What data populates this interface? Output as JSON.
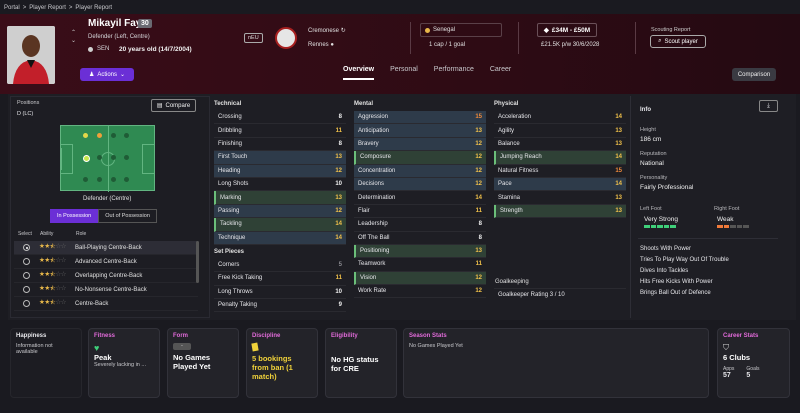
{
  "breadcrumb": [
    "Portal",
    "Player Report",
    "Player Report"
  ],
  "player": {
    "name": "Mikayil Faye",
    "number": "30",
    "position": "Defender (Left, Centre)",
    "nationality_code": "SEN",
    "age": "20 years old (14/7/2004)",
    "eu": "nEU"
  },
  "clubs": {
    "current": "Cremonese",
    "parent": "Rennes"
  },
  "nation": {
    "name": "Senegal",
    "caps": "1 cap / 1 goal"
  },
  "value": {
    "range": "£34M - £50M",
    "wage": "£21.5K p/w 30/6/2028"
  },
  "scouting": {
    "label": "Scouting Report",
    "button": "Scout player"
  },
  "actions_label": "Actions",
  "tabs": [
    "Overview",
    "Personal",
    "Performance",
    "Career"
  ],
  "comparison_label": "Comparison",
  "positions": {
    "label": "Positions",
    "value": "D (LC)",
    "compare_label": "Compare",
    "role_name": "Defender (Centre)",
    "in_possession": "In Possession",
    "out_possession": "Out of Possession",
    "headers": [
      "Select",
      "Ability",
      "Role"
    ],
    "roles": [
      {
        "name": "Ball-Playing Centre-Back",
        "stars": 2.5,
        "selected": true
      },
      {
        "name": "Advanced Centre-Back",
        "stars": 2.5,
        "selected": false
      },
      {
        "name": "Overlapping Centre-Back",
        "stars": 2.5,
        "selected": false
      },
      {
        "name": "No-Nonsense Centre-Back",
        "stars": 2.5,
        "selected": false
      },
      {
        "name": "Centre-Back",
        "stars": 2.5,
        "selected": false
      }
    ]
  },
  "technical": {
    "title": "Technical",
    "rows": [
      {
        "n": "Crossing",
        "v": "8",
        "c": "w",
        "h": ""
      },
      {
        "n": "Dribbling",
        "v": "11",
        "c": "y",
        "h": ""
      },
      {
        "n": "Finishing",
        "v": "8",
        "c": "w",
        "h": ""
      },
      {
        "n": "First Touch",
        "v": "13",
        "c": "y",
        "h": "hl"
      },
      {
        "n": "Heading",
        "v": "12",
        "c": "y",
        "h": "hl"
      },
      {
        "n": "Long Shots",
        "v": "10",
        "c": "w",
        "h": ""
      },
      {
        "n": "Marking",
        "v": "13",
        "c": "y",
        "h": "hlg"
      },
      {
        "n": "Passing",
        "v": "12",
        "c": "y",
        "h": "hl"
      },
      {
        "n": "Tackling",
        "v": "14",
        "c": "y",
        "h": "hlg"
      },
      {
        "n": "Technique",
        "v": "14",
        "c": "y",
        "h": "hl"
      }
    ]
  },
  "setpieces": {
    "title": "Set Pieces",
    "rows": [
      {
        "n": "Corners",
        "v": "5",
        "c": "g",
        "h": ""
      },
      {
        "n": "Free Kick Taking",
        "v": "11",
        "c": "y",
        "h": ""
      },
      {
        "n": "Long Throws",
        "v": "10",
        "c": "w",
        "h": ""
      },
      {
        "n": "Penalty Taking",
        "v": "9",
        "c": "w",
        "h": ""
      }
    ]
  },
  "mental": {
    "title": "Mental",
    "rows": [
      {
        "n": "Aggression",
        "v": "15",
        "c": "o",
        "h": "hl"
      },
      {
        "n": "Anticipation",
        "v": "13",
        "c": "y",
        "h": "hl"
      },
      {
        "n": "Bravery",
        "v": "12",
        "c": "y",
        "h": "hl"
      },
      {
        "n": "Composure",
        "v": "12",
        "c": "y",
        "h": "hlg"
      },
      {
        "n": "Concentration",
        "v": "12",
        "c": "y",
        "h": "hl"
      },
      {
        "n": "Decisions",
        "v": "12",
        "c": "y",
        "h": "hl"
      },
      {
        "n": "Determination",
        "v": "14",
        "c": "y",
        "h": ""
      },
      {
        "n": "Flair",
        "v": "11",
        "c": "y",
        "h": ""
      },
      {
        "n": "Leadership",
        "v": "8",
        "c": "w",
        "h": ""
      },
      {
        "n": "Off The Ball",
        "v": "8",
        "c": "w",
        "h": ""
      },
      {
        "n": "Positioning",
        "v": "13",
        "c": "y",
        "h": "hlg"
      },
      {
        "n": "Teamwork",
        "v": "11",
        "c": "y",
        "h": ""
      },
      {
        "n": "Vision",
        "v": "12",
        "c": "y",
        "h": "hlg"
      },
      {
        "n": "Work Rate",
        "v": "12",
        "c": "y",
        "h": ""
      }
    ]
  },
  "physical": {
    "title": "Physical",
    "rows": [
      {
        "n": "Acceleration",
        "v": "14",
        "c": "y",
        "h": ""
      },
      {
        "n": "Agility",
        "v": "13",
        "c": "y",
        "h": ""
      },
      {
        "n": "Balance",
        "v": "13",
        "c": "y",
        "h": ""
      },
      {
        "n": "Jumping Reach",
        "v": "14",
        "c": "y",
        "h": "hlg"
      },
      {
        "n": "Natural Fitness",
        "v": "15",
        "c": "o",
        "h": ""
      },
      {
        "n": "Pace",
        "v": "14",
        "c": "y",
        "h": "hl"
      },
      {
        "n": "Stamina",
        "v": "13",
        "c": "y",
        "h": ""
      },
      {
        "n": "Strength",
        "v": "13",
        "c": "y",
        "h": "hlg"
      }
    ]
  },
  "goalkeeping": {
    "title": "Goalkeeping",
    "rating": "Goalkeeper Rating  3 / 10"
  },
  "info": {
    "title": "Info",
    "height_label": "Height",
    "height": "186 cm",
    "reputation_label": "Reputation",
    "reputation": "National",
    "personality_label": "Personality",
    "personality": "Fairly Professional",
    "left_foot_label": "Left Foot",
    "left_foot": "Very Strong",
    "left_foot_level": 5,
    "right_foot_label": "Right Foot",
    "right_foot": "Weak",
    "right_foot_level": 2,
    "traits": [
      "Shoots With Power",
      "Tries To Play Way Out Of Trouble",
      "Dives Into Tackles",
      "Hits Free Kicks With Power",
      "Brings Ball Out of Defence"
    ]
  },
  "cards": {
    "happiness": {
      "title": "Happiness",
      "text": "Information not available"
    },
    "fitness": {
      "title": "Fitness",
      "big": "Peak",
      "small": "Severely lacking in ..."
    },
    "form": {
      "title": "Form",
      "badge": "-",
      "big": "No Games Played Yet"
    },
    "discipline": {
      "title": "Discipline",
      "big": "5 bookings from ban (1 match)"
    },
    "eligibility": {
      "title": "Eligibility",
      "big": "No HG status for CRE"
    },
    "season": {
      "title": "Season Stats",
      "text": "No Games Played Yet"
    },
    "career": {
      "title": "Career Stats",
      "big": "6 Clubs",
      "apps_label": "Apps",
      "apps": "57",
      "goals_label": "Goals",
      "goals": "5"
    }
  },
  "colors": {
    "accent": "#6b2fd6",
    "header": "#3a0d18",
    "pitch": "#2f8a52",
    "star": "#e8b84a"
  }
}
